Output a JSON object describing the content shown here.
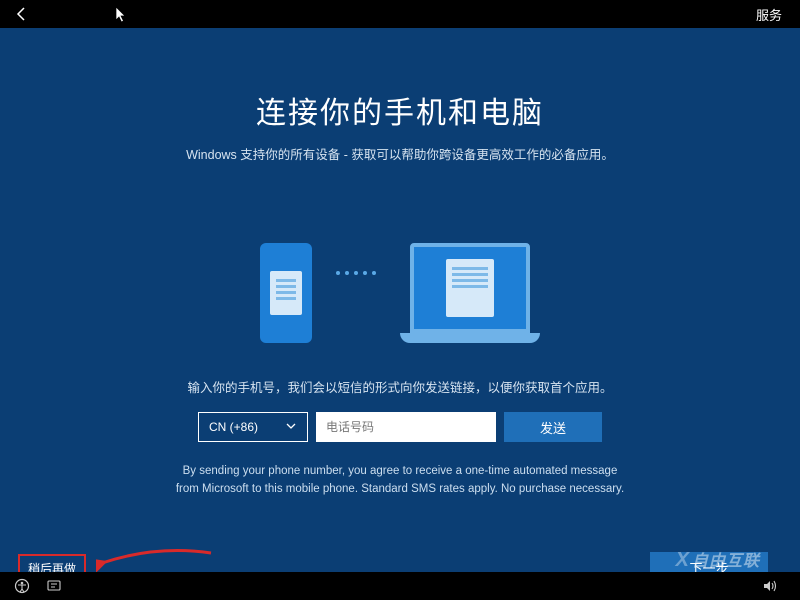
{
  "topbar": {
    "services_label": "服务"
  },
  "header": {
    "title": "连接你的手机和电脑",
    "subtitle": "Windows 支持你的所有设备 - 获取可以帮助你跨设备更高效工作的必备应用。"
  },
  "form": {
    "instruction": "输入你的手机号，我们会以短信的形式向你发送链接，以便你获取首个应用。",
    "country_code_label": "CN (+86)",
    "phone_placeholder": "电话号码",
    "phone_value": "",
    "send_label": "发送"
  },
  "disclaimer": {
    "line1": "By sending your phone number, you agree to receive a one-time automated message",
    "line2": "from Microsoft to this mobile phone. Standard SMS rates apply. No purchase necessary."
  },
  "actions": {
    "later_label": "稍后再做",
    "next_label": "下一步"
  },
  "watermark": "自由互联"
}
